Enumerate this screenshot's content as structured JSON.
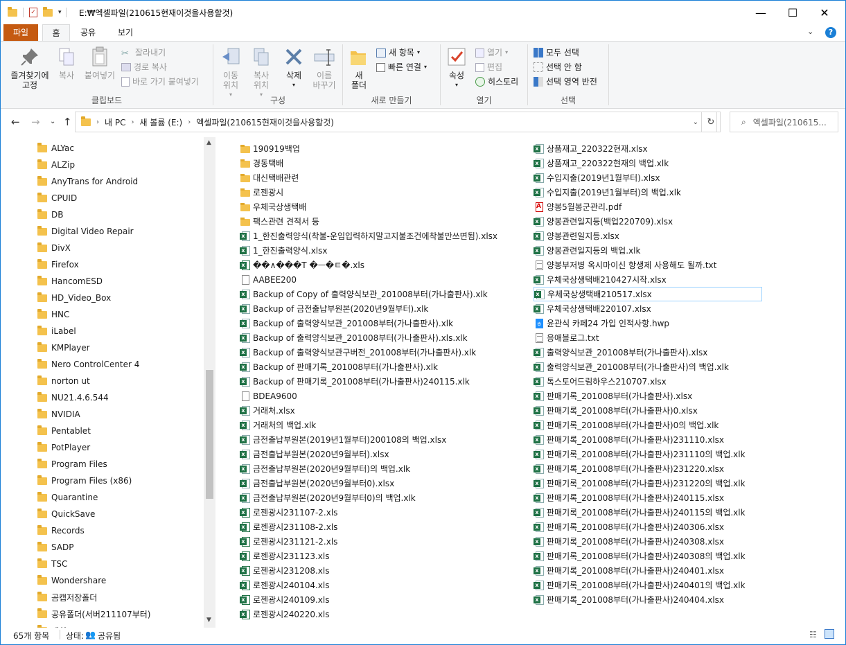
{
  "window": {
    "title": "E:₩엑셀파일(210615현재이것을사용할것)",
    "minimize": "—",
    "maximize": "☐",
    "close": "✕"
  },
  "tabs": [
    "파일",
    "홈",
    "공유",
    "보기"
  ],
  "ribbon": {
    "clipboard": {
      "label": "클립보드",
      "pin": "즐겨찾기에\n고정",
      "copy": "복사",
      "paste": "붙여넣기",
      "cut": "잘라내기",
      "copy_path": "경로 복사",
      "paste_shortcut": "바로 가기 붙여넣기"
    },
    "organize": {
      "label": "구성",
      "move": "이동\n위치",
      "copyto": "복사\n위치",
      "delete": "삭제",
      "rename": "이름\n바꾸기"
    },
    "new": {
      "label": "새로 만들기",
      "new_folder": "새\n폴더",
      "new_item": "새 항목",
      "easy_access": "빠른 연결"
    },
    "open": {
      "label": "열기",
      "properties": "속성",
      "open": "열기",
      "edit": "편집",
      "history": "히스토리"
    },
    "select": {
      "label": "선택",
      "all": "모두 선택",
      "none": "선택 안 함",
      "invert": "선택 영역 반전"
    }
  },
  "address": {
    "path": [
      "내 PC",
      "새 볼륨 (E:)",
      "엑셀파일(210615현재이것을사용할것)"
    ],
    "search_placeholder": "엑셀파일(210615..."
  },
  "nav_items": [
    "ALYac",
    "ALZip",
    "AnyTrans for Android",
    "CPUID",
    "DB",
    "Digital Video Repair",
    "DivX",
    "Firefox",
    "HancomESD",
    "HD_Video_Box",
    "HNC",
    "iLabel",
    "KMPlayer",
    "Nero ControlCenter 4",
    "norton ut",
    "NU21.4.6.544",
    "NVIDIA",
    "Pentablet",
    "PotPlayer",
    "Program Files",
    "Program Files (x86)",
    "Quarantine",
    "QuickSave",
    "Records",
    "SADP",
    "TSC",
    "Wondershare",
    "곰캡저장폴더",
    "공유폴더(서버211107부터)",
    "패치"
  ],
  "files_col1": [
    {
      "name": "190919백업",
      "type": "folder"
    },
    {
      "name": "경동택배",
      "type": "folder"
    },
    {
      "name": "대신택배관련",
      "type": "folder"
    },
    {
      "name": "로젠광시",
      "type": "folder"
    },
    {
      "name": "우체국상생택배",
      "type": "folder"
    },
    {
      "name": "팩스관련 견적서 등",
      "type": "folder"
    },
    {
      "name": "1_한진출력양식(착불-운임입력하지말고지불조건에착불만쓰면됨).xlsx",
      "type": "xlsx"
    },
    {
      "name": "1_한진출력양식.xlsx",
      "type": "xlsx"
    },
    {
      "name": "��∧���T �ㅡ�ㅌ�.xls",
      "type": "xls"
    },
    {
      "name": "AABEE200",
      "type": "file"
    },
    {
      "name": "Backup of Copy of 출력양식보관_201008부터(가나출판사).xlk",
      "type": "xlsx"
    },
    {
      "name": "Backup of 금전출납부원본(2020년9월부터).xlk",
      "type": "xlsx"
    },
    {
      "name": "Backup of 출력양식보관_201008부터(가나출판사).xlk",
      "type": "xlsx"
    },
    {
      "name": "Backup of 출력양식보관_201008부터(가나출판사).xls.xlk",
      "type": "xlsx"
    },
    {
      "name": "Backup of 출력양식보관구버전_201008부터(가나출판사).xlk",
      "type": "xlsx"
    },
    {
      "name": "Backup of 판매기록_201008부터(가나출판사).xlk",
      "type": "xlsx"
    },
    {
      "name": "Backup of 판매기록_201008부터(가나출판사)240115.xlk",
      "type": "xlsx"
    },
    {
      "name": "BDEA9600",
      "type": "file"
    },
    {
      "name": "거래처.xlsx",
      "type": "xlsx"
    },
    {
      "name": "거래처의 백업.xlk",
      "type": "xlsx"
    },
    {
      "name": "금전출납부원본(2019년1월부터)200108의 백업.xlsx",
      "type": "xlsx"
    },
    {
      "name": "금전출납부원본(2020년9월부터).xlsx",
      "type": "xlsx"
    },
    {
      "name": "금전출납부원본(2020년9월부터)의 백업.xlk",
      "type": "xlsx"
    },
    {
      "name": "금전출납부원본(2020년9월부터0).xlsx",
      "type": "xlsx"
    },
    {
      "name": "금전출납부원본(2020년9월부터0)의 백업.xlk",
      "type": "xlsx"
    },
    {
      "name": "로젠광시231107-2.xls",
      "type": "xls"
    },
    {
      "name": "로젠광시231108-2.xls",
      "type": "xls"
    },
    {
      "name": "로젠광시231121-2.xls",
      "type": "xls"
    },
    {
      "name": "로젠광시231123.xls",
      "type": "xls"
    },
    {
      "name": "로젠광시231208.xls",
      "type": "xls"
    },
    {
      "name": "로젠광시240104.xls",
      "type": "xls"
    },
    {
      "name": "로젠광시240109.xls",
      "type": "xls"
    },
    {
      "name": "로젠광시240220.xls",
      "type": "xls"
    }
  ],
  "files_col2": [
    {
      "name": "상품재고_220322현재.xlsx",
      "type": "xlsx"
    },
    {
      "name": "상품재고_220322현재의 백업.xlk",
      "type": "xlsx"
    },
    {
      "name": "수입지출(2019년1월부터).xlsx",
      "type": "xlsx"
    },
    {
      "name": "수입지출(2019년1월부터)의 백업.xlk",
      "type": "xlsx"
    },
    {
      "name": "양봉5월봉군관리.pdf",
      "type": "pdf"
    },
    {
      "name": "양봉관련일지등(백업220709).xlsx",
      "type": "xlsx"
    },
    {
      "name": "양봉관련일지등.xlsx",
      "type": "xlsx"
    },
    {
      "name": "양봉관련일지등의 백업.xlk",
      "type": "xlsx"
    },
    {
      "name": "양봉부저병 옥시마이신 항생제 사용해도 될까.txt",
      "type": "txt"
    },
    {
      "name": "우체국상생택배210427시작.xlsx",
      "type": "xlsx"
    },
    {
      "name": "우체국상생택배210517.xlsx",
      "type": "xlsx"
    },
    {
      "name": "우체국상생택배220107.xlsx",
      "type": "xlsx"
    },
    {
      "name": "윤관식 카페24 가입 인적사항.hwp",
      "type": "hwp"
    },
    {
      "name": "응애블로그.txt",
      "type": "txt"
    },
    {
      "name": "출력양식보관_201008부터(가나출판사).xlsx",
      "type": "xlsx"
    },
    {
      "name": "출력양식보관_201008부터(가나출판사)의 백업.xlk",
      "type": "xlsx"
    },
    {
      "name": "톡스토어드림하우스210707.xlsx",
      "type": "xlsx"
    },
    {
      "name": "판매기록_201008부터(가나출판사).xlsx",
      "type": "xlsx"
    },
    {
      "name": "판매기록_201008부터(가나출판사)0.xlsx",
      "type": "xlsx"
    },
    {
      "name": "판매기록_201008부터(가나출판사)0의 백업.xlk",
      "type": "xlsx"
    },
    {
      "name": "판매기록_201008부터(가나출판사)231110.xlsx",
      "type": "xlsx"
    },
    {
      "name": "판매기록_201008부터(가나출판사)231110의 백업.xlk",
      "type": "xlsx"
    },
    {
      "name": "판매기록_201008부터(가나출판사)231220.xlsx",
      "type": "xlsx"
    },
    {
      "name": "판매기록_201008부터(가나출판사)231220의 백업.xlk",
      "type": "xlsx"
    },
    {
      "name": "판매기록_201008부터(가나출판사)240115.xlsx",
      "type": "xlsx"
    },
    {
      "name": "판매기록_201008부터(가나출판사)240115의 백업.xlk",
      "type": "xlsx"
    },
    {
      "name": "판매기록_201008부터(가나출판사)240306.xlsx",
      "type": "xlsx"
    },
    {
      "name": "판매기록_201008부터(가나출판사)240308.xlsx",
      "type": "xlsx"
    },
    {
      "name": "판매기록_201008부터(가나출판사)240308의 백업.xlk",
      "type": "xlsx"
    },
    {
      "name": "판매기록_201008부터(가나출판사)240401.xlsx",
      "type": "xlsx"
    },
    {
      "name": "판매기록_201008부터(가나출판사)240401의 백업.xlk",
      "type": "xlsx"
    },
    {
      "name": "판매기록_201008부터(가나출판사)240404.xlsx",
      "type": "xlsx"
    }
  ],
  "selected_file": "우체국상생택배210517.xlsx",
  "status": {
    "count": "65개 항목",
    "state_label": "상태:",
    "state_value": "공유됨"
  },
  "colors": {
    "file_tab": "#c55a11",
    "accent": "#1a7fd6",
    "folder": "#f4c24d",
    "excel": "#1e7145"
  }
}
